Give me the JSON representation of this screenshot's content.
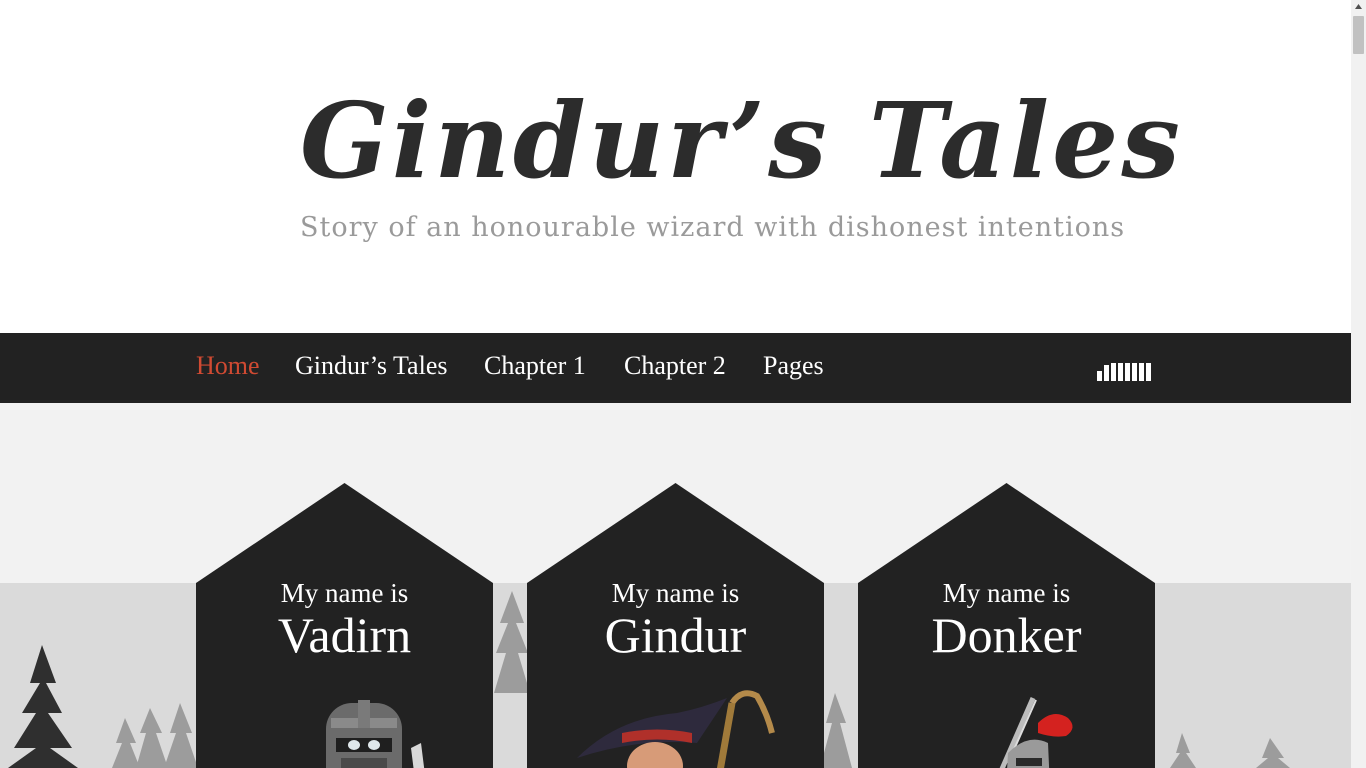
{
  "header": {
    "title": "Gindur’s Tales",
    "tagline": "Story of an honourable wizard with dishonest intentions"
  },
  "nav": {
    "items": [
      {
        "label": "Home",
        "active": true
      },
      {
        "label": "Gindur’s Tales",
        "active": false
      },
      {
        "label": "Chapter 1",
        "active": false
      },
      {
        "label": "Chapter 2",
        "active": false
      },
      {
        "label": "Pages",
        "active": false
      }
    ],
    "social_icon": "bars-icon"
  },
  "colors": {
    "nav_bg": "#222222",
    "accent": "#d04a32",
    "card_bg": "#222222",
    "content_bg": "#f2f2f2",
    "ground_bg": "#dadada",
    "tagline": "#9a9a9a"
  },
  "characters": [
    {
      "intro": "My name is",
      "name": "Vadirn",
      "avatar": "knight-helmet-icon"
    },
    {
      "intro": "My name is",
      "name": "Gindur",
      "avatar": "wizard-icon"
    },
    {
      "intro": "My name is",
      "name": "Donker",
      "avatar": "knight-plume-icon"
    }
  ]
}
